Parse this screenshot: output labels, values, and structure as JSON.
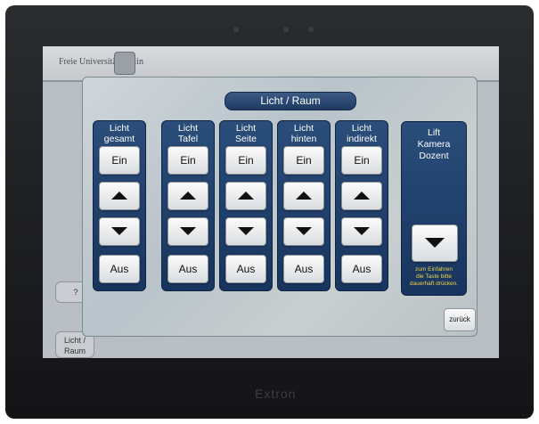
{
  "background": {
    "header_logo": "Freie Universität Berlin",
    "left_button_1": "?",
    "left_button_2": "Licht / Raum"
  },
  "panel": {
    "title": "Licht / Raum",
    "columns": [
      {
        "label": "Licht\ngesamt",
        "on": "Ein",
        "off": "Aus"
      },
      {
        "label": "Licht\nTafel",
        "on": "Ein",
        "off": "Aus"
      },
      {
        "label": "Licht\nSeite",
        "on": "Ein",
        "off": "Aus"
      },
      {
        "label": "Licht\nhinten",
        "on": "Ein",
        "off": "Aus"
      },
      {
        "label": "Licht\nindirekt",
        "on": "Ein",
        "off": "Aus"
      }
    ],
    "lift": {
      "label": "Lift\nKamera\nDozent",
      "hint": "zum Einfahren\ndie Taste bitte\ndauerhaft drücken."
    },
    "back": "zurück"
  },
  "device": {
    "brand": "Extron"
  }
}
